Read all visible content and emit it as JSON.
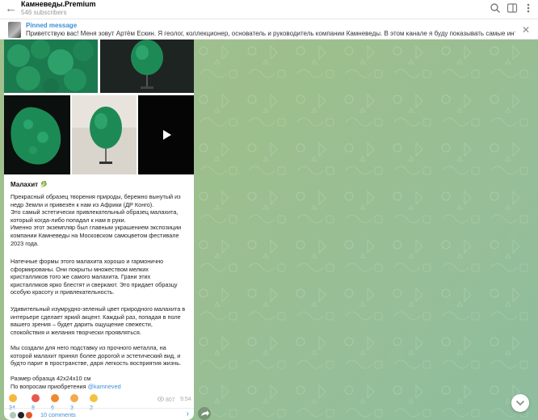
{
  "header": {
    "title": "Камневеды.Premium",
    "subtitle": "546 subscribers"
  },
  "pinned": {
    "title": "Pinned message",
    "text": "Приветствую вас! Меня зовут Артём Ескин. Я геолог, коллекционер, основатель и руководитель компании Камневеды. В этом канале я буду показывать самые интересные экс..."
  },
  "message": {
    "heading": "Малахит 🥬",
    "para1": [
      "Прекрасный образец творения природы, бережно вынутый из",
      "недр Земли и привезён к нам из Африки (ДР Конго).",
      "Это самый эстетически привлекательный образец малахита,",
      "который когда-либо попадал к нам в руки.",
      "Именно этот экземпляр был главным украшением экспозиции",
      "компании Камневеды на Московском самоцветом фестивале",
      "2023 года."
    ],
    "para2": [
      "Натечные формы этого малахита хорошо и гармонично",
      "сформированы. Они покрыты множеством мелких",
      "кристалликов того же самого малахита. Грани этих",
      "кристалликов ярко блестят и сверкают. Это придает образцу",
      "особую красоту и привлекательность."
    ],
    "para3": [
      "Удивительный изумрудно-зеленый цвет природного малахита в",
      "интерьере сделает яркий акцент. Каждый раз, попадая в поле",
      "вашего зрения – будет дарить ощущение свежести,",
      "спокойствия и желания творчески проявляться."
    ],
    "para4": [
      "Мы создали для него подставку из прочного металла, на",
      "которой малахит принял более дорогой и эстетический вид, и",
      "будто парит в пространстве, даря легкость восприятия жизнь."
    ],
    "size_line": "Размер образца 42х24х10 см",
    "contact_prefix": "По вопросам приобретения ",
    "contact_link": "@kamneved",
    "views": "807",
    "time": "9:54",
    "reactions": [
      {
        "emoji": "👍",
        "count": "34",
        "color": "#f5b93a"
      },
      {
        "emoji": "❤️",
        "count": "8",
        "color": "#e8574a"
      },
      {
        "emoji": "🔥",
        "count": "6",
        "color": "#f08a2a"
      },
      {
        "emoji": "👏",
        "count": "3",
        "color": "#f5a94a"
      },
      {
        "emoji": "🤩",
        "count": "2",
        "color": "#f3c23f"
      }
    ],
    "comments_label": "10 comments"
  },
  "colors": {
    "accent": "#3a8fd3",
    "malachite": "#1f8a5a",
    "chat_bg": "#9dbf8d"
  },
  "icons": {
    "back": "arrow-left-icon",
    "search": "search-icon",
    "sidebar": "sidebar-toggle-icon",
    "more": "more-vertical-icon",
    "close": "close-icon",
    "play": "play-icon",
    "views": "eye-icon",
    "share": "share-icon",
    "scroll": "chevron-down-icon"
  }
}
